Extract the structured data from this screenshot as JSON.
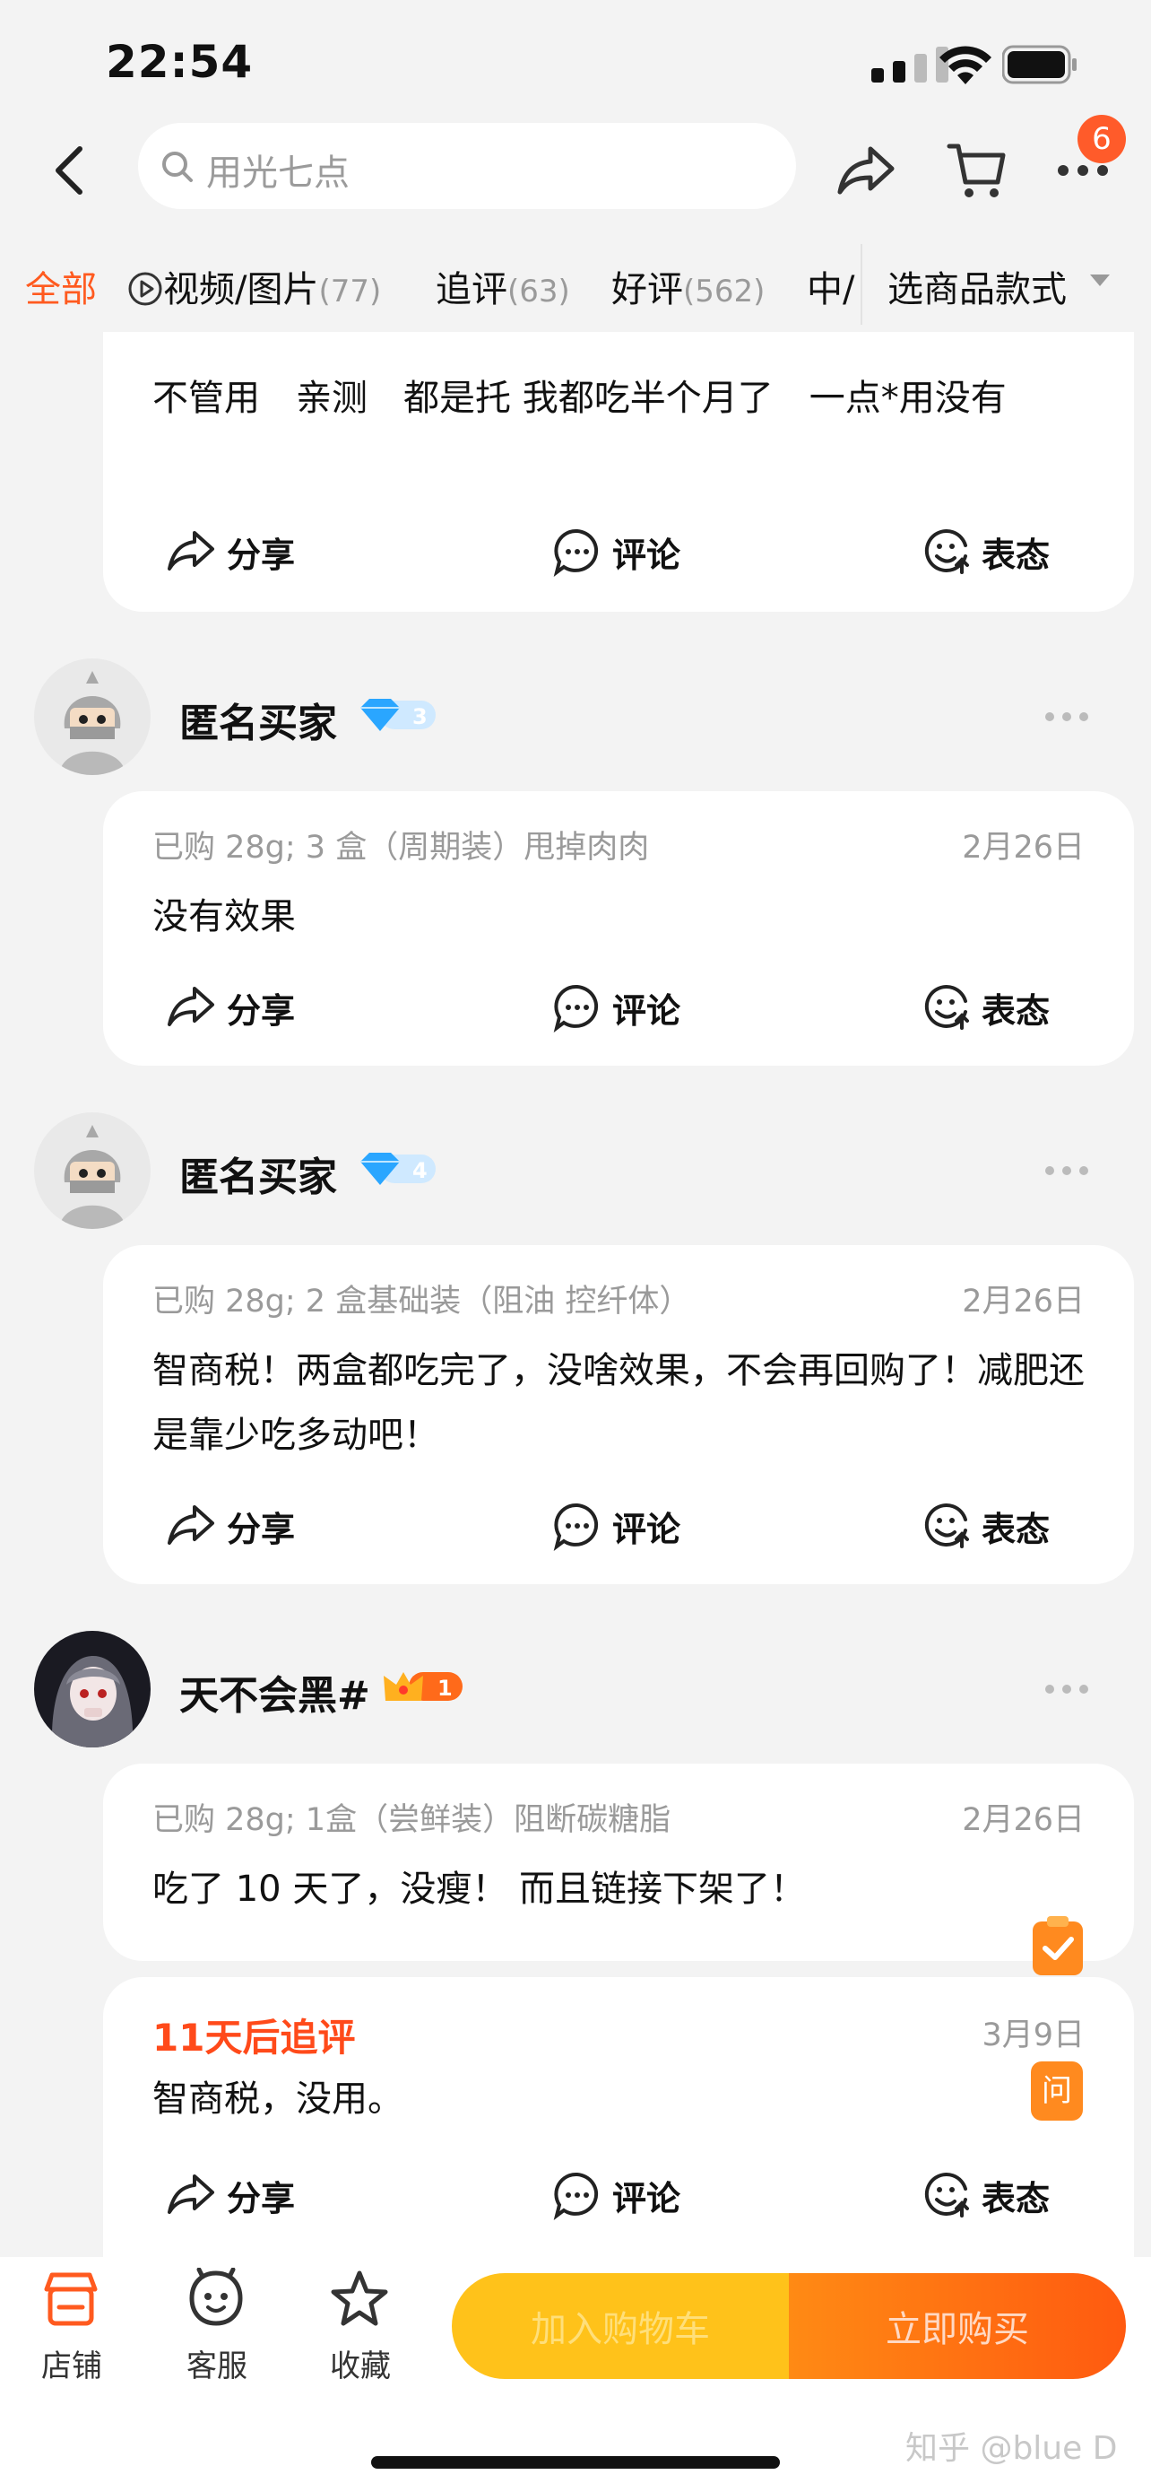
{
  "status_bar": {
    "time": "22:54"
  },
  "header": {
    "search_placeholder": "用光七点",
    "more_badge": "6"
  },
  "tabs": [
    {
      "label": "全部",
      "count": ""
    },
    {
      "label": "视频/图片",
      "count": "(77)"
    },
    {
      "label": "追评",
      "count": "(63)"
    },
    {
      "label": "好评",
      "count": "(562)"
    },
    {
      "label": "中/",
      "count": ""
    }
  ],
  "sku_filter": "选商品款式",
  "actions": {
    "share": "分享",
    "comment": "评论",
    "react": "表态"
  },
  "reviews": [
    {
      "text": "不管用　亲测　都是托  我都吃半个月了　一点*用没有"
    },
    {
      "user": "匿名买家",
      "level": "3",
      "meta": "已购 28g; 3 盒（周期装）甩掉肉肉",
      "date": "2月26日",
      "text": "没有效果"
    },
    {
      "user": "匿名买家",
      "level": "4",
      "meta": "已购 28g; 2 盒基础装（阻油 控纤体）",
      "date": "2月26日",
      "text": "智商税！两盒都吃完了，没啥效果，不会再回购了！减肥还是靠少吃多动吧！"
    },
    {
      "user": "天不会黑#",
      "level": "1",
      "meta": "已购 28g; 1盒（尝鲜装）阻断碳糖脂",
      "date": "2月26日",
      "text": "吃了 10 天了，没瘦！ 而且链接下架了！",
      "followup": {
        "title": "11天后追评",
        "date": "3月9日",
        "text": "智商税，没用。"
      }
    }
  ],
  "float_ask": "问",
  "bottom_nav": [
    {
      "label": "店铺"
    },
    {
      "label": "客服"
    },
    {
      "label": "收藏"
    }
  ],
  "buttons": {
    "add_cart": "加入购物车",
    "buy_now": "立即购买"
  },
  "watermark": "知乎 @blue D",
  "colors": {
    "accent": "#ff5a1f",
    "cart": "#ffc21a",
    "buy": "#ff6a10"
  }
}
